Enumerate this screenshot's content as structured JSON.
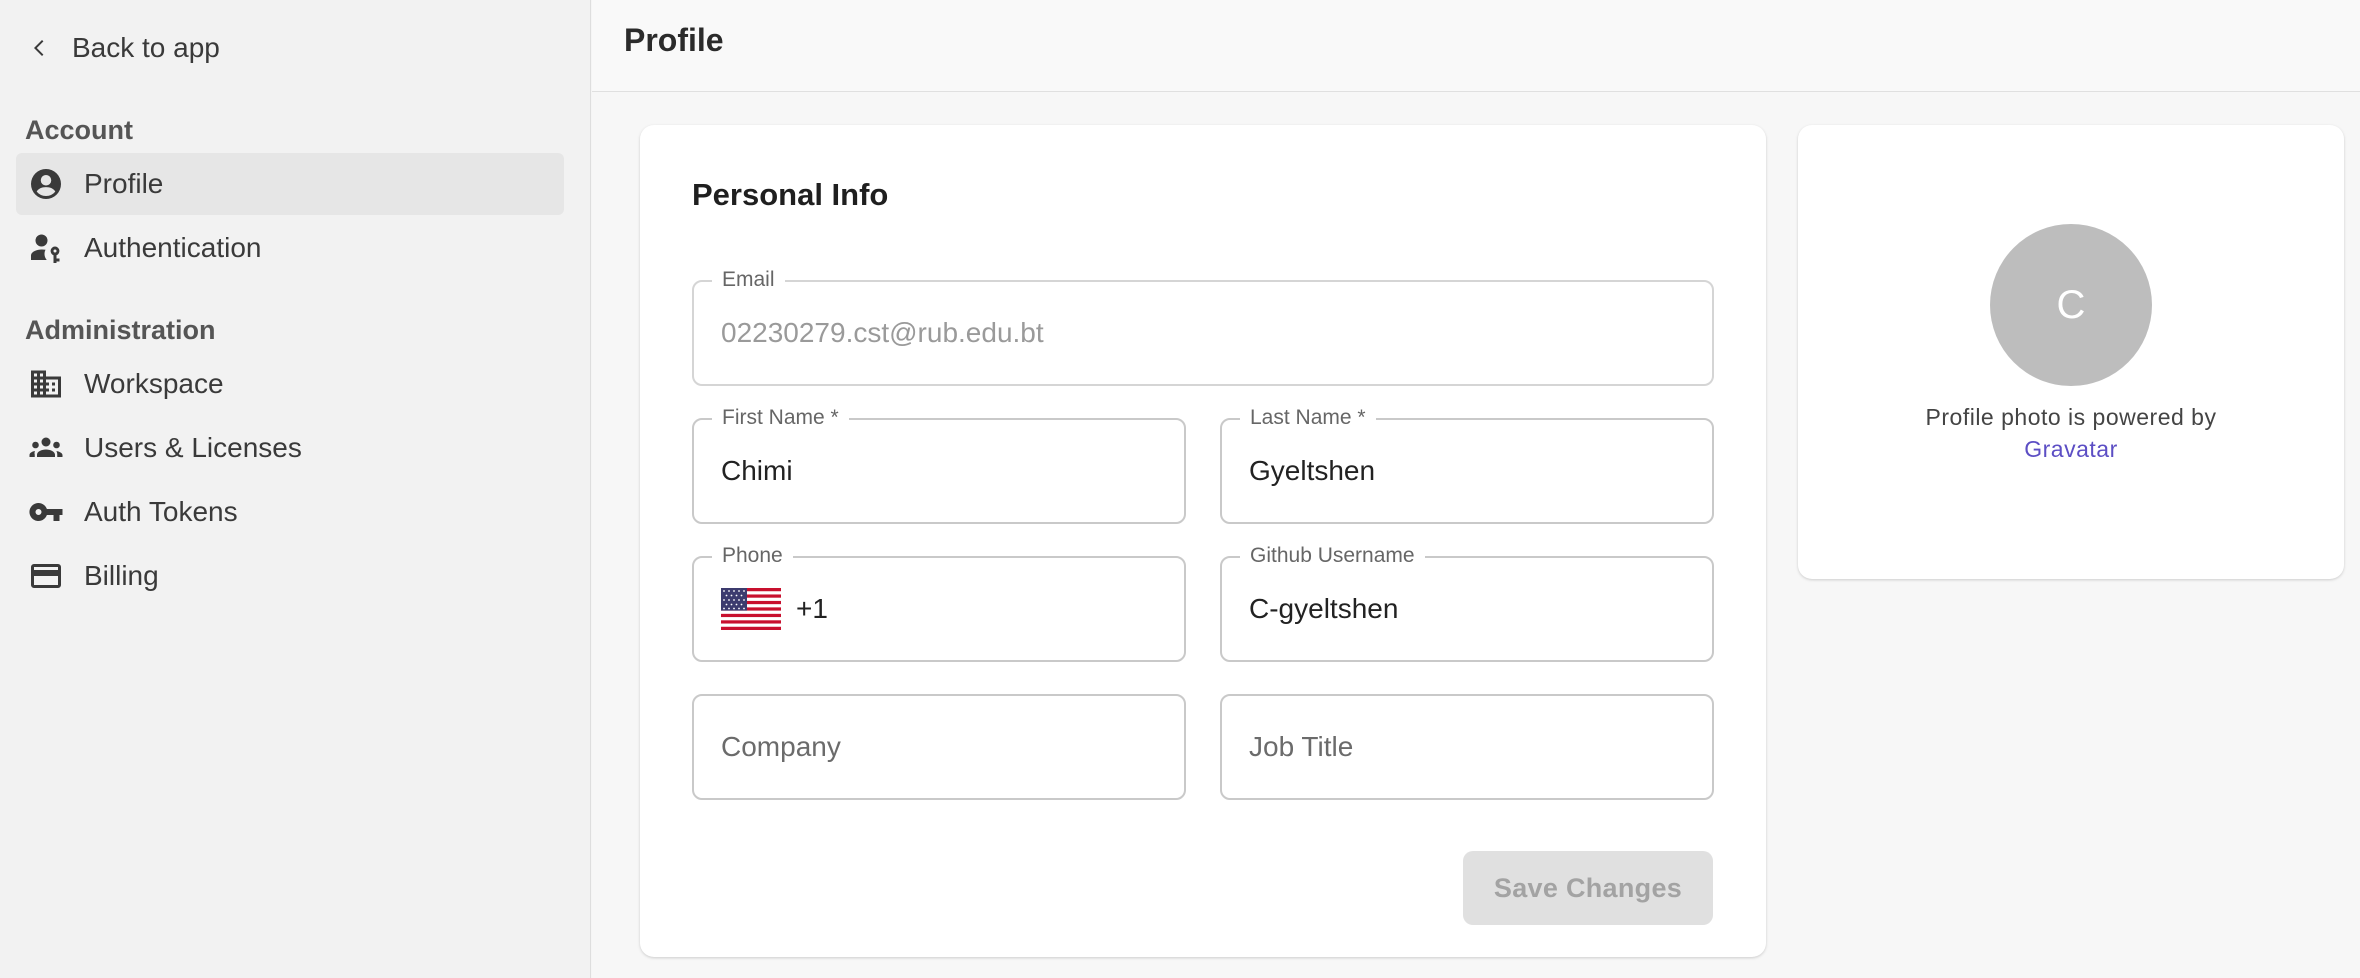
{
  "sidebar": {
    "back_label": "Back to app",
    "sections": [
      {
        "title": "Account"
      },
      {
        "title": "Administration"
      }
    ],
    "items": [
      {
        "label": "Profile",
        "icon": "account-circle-icon",
        "active": true
      },
      {
        "label": "Authentication",
        "icon": "person-key-icon"
      },
      {
        "label": "Workspace",
        "icon": "building-icon"
      },
      {
        "label": "Users & Licenses",
        "icon": "people-icon"
      },
      {
        "label": "Auth Tokens",
        "icon": "key-icon"
      },
      {
        "label": "Billing",
        "icon": "credit-card-icon"
      }
    ]
  },
  "header": {
    "title": "Profile"
  },
  "personal_info": {
    "title": "Personal Info",
    "email": {
      "label": "Email",
      "value": "02230279.cst@rub.edu.bt"
    },
    "first_name": {
      "label": "First Name *",
      "value": "Chimi"
    },
    "last_name": {
      "label": "Last Name *",
      "value": "Gyeltshen"
    },
    "phone": {
      "label": "Phone",
      "country": "us-flag-icon",
      "code": "+1"
    },
    "github": {
      "label": "Github Username",
      "value": "C-gyeltshen"
    },
    "company": {
      "placeholder": "Company"
    },
    "job_title": {
      "placeholder": "Job Title"
    },
    "save_label": "Save Changes"
  },
  "photo": {
    "initial": "C",
    "note": "Profile photo is powered by",
    "link_label": "Gravatar"
  },
  "colors": {
    "link": "#5c4ec4",
    "avatar": "#bdbdbd",
    "active_nav": "#e6e6e6"
  }
}
